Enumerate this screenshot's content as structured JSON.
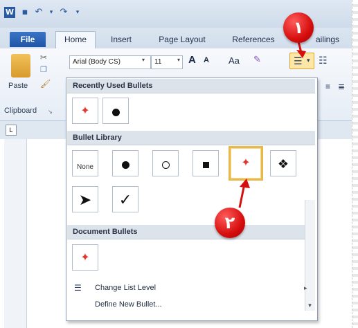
{
  "tabs": {
    "file": "File",
    "home": "Home",
    "insert": "Insert",
    "page_layout": "Page Layout",
    "references": "References",
    "mailings": "ailings"
  },
  "ribbon": {
    "font_name": "Arial (Body CS)",
    "font_size": "11",
    "paste": "Paste",
    "clipboard": "Clipboard",
    "grow_font": "A",
    "shrink_font": "A",
    "change_case": "Aa"
  },
  "gallery": {
    "recently_used": "Recently Used Bullets",
    "library": "Bullet Library",
    "document": "Document Bullets",
    "none_label": "None",
    "change_level": "Change List Level",
    "define_new": "Define New Bullet..."
  },
  "badges": {
    "one": "١",
    "two": "٢"
  },
  "colors": {
    "badge": "#d60e0e",
    "selected": "#e8b84a",
    "file_tab": "#2b63b6"
  }
}
